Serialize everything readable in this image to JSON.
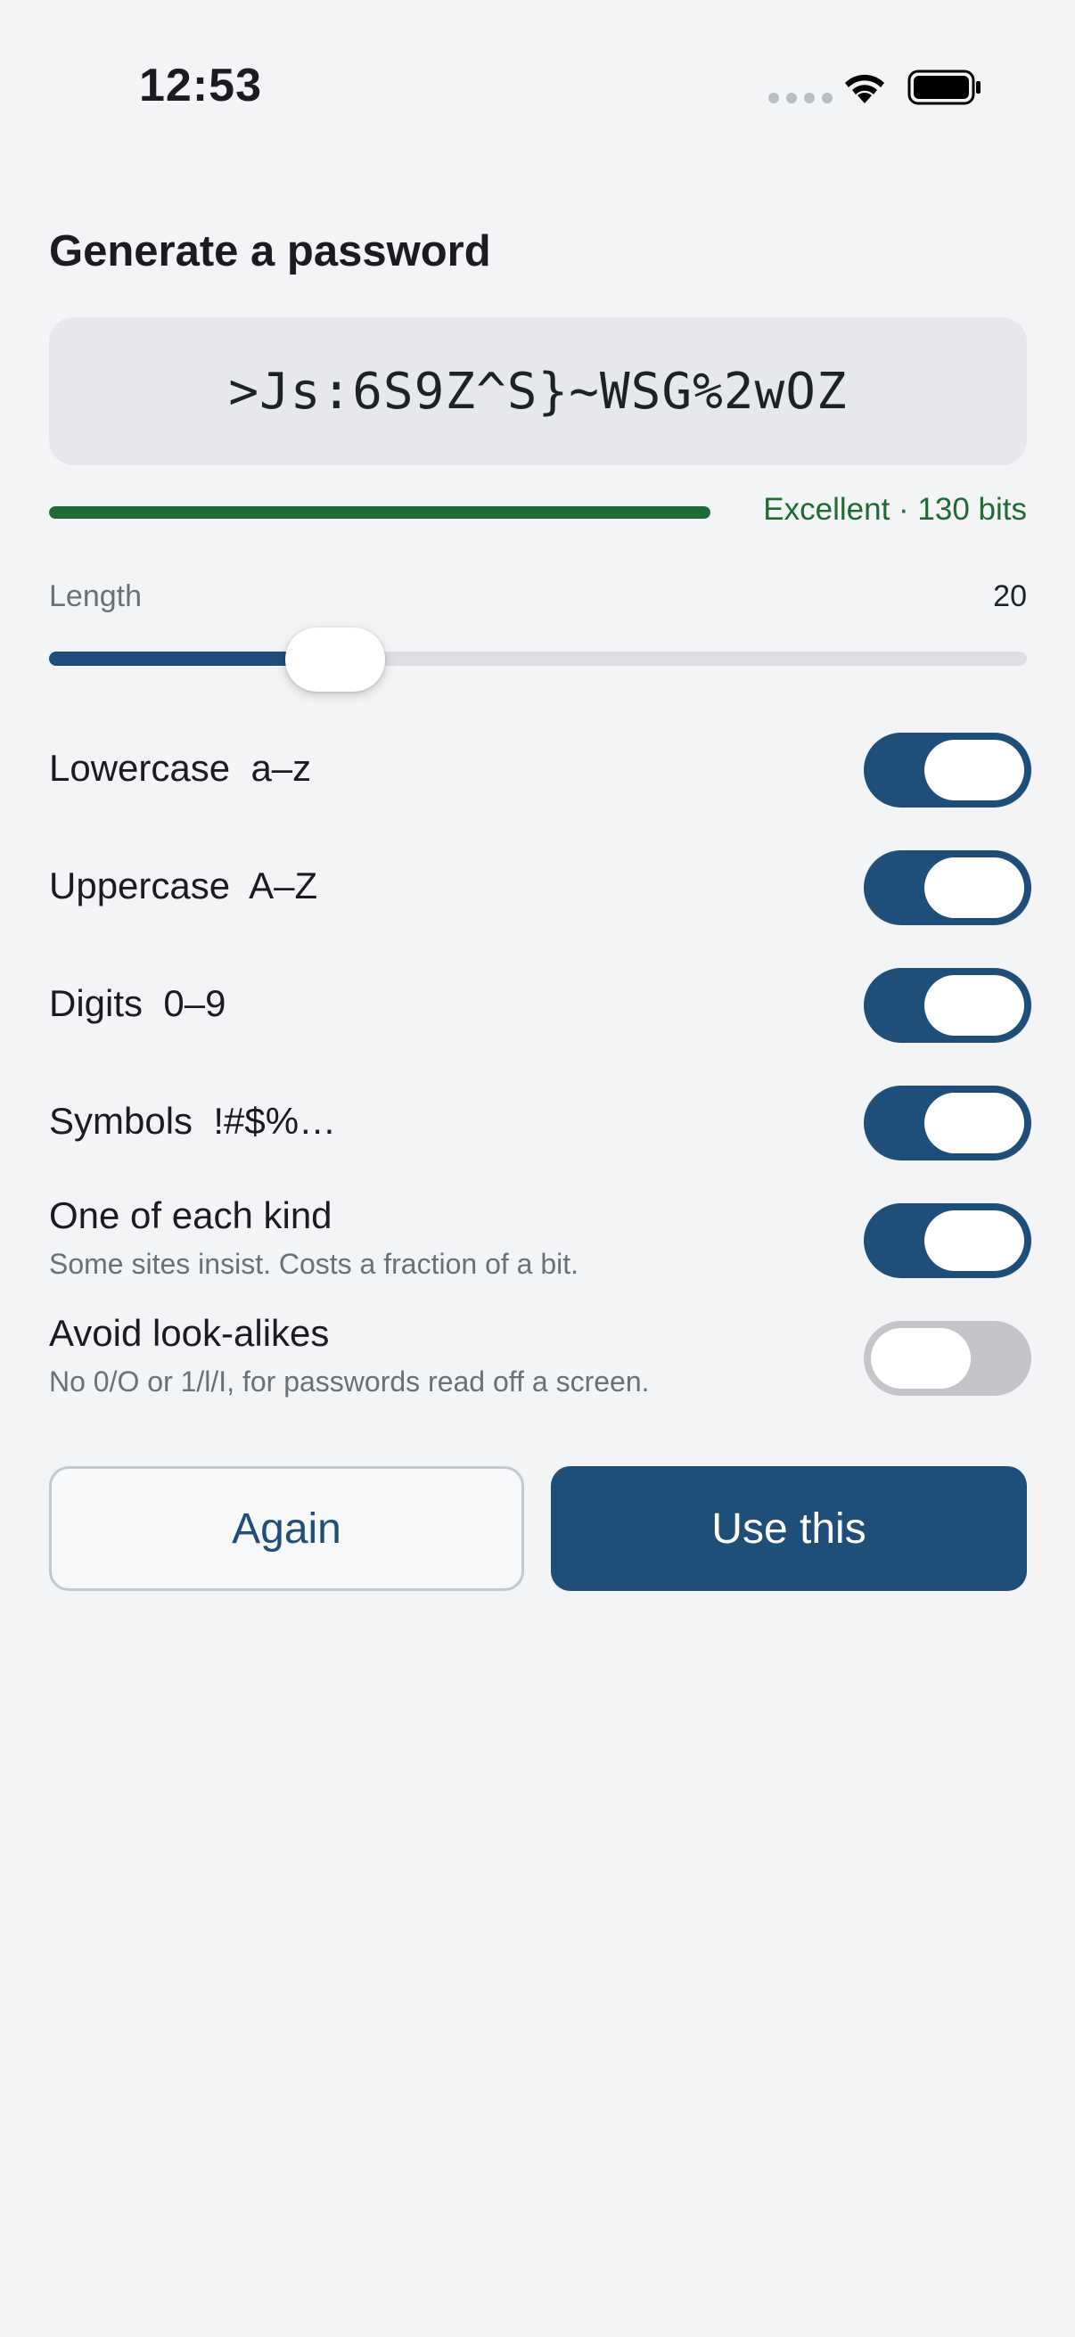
{
  "status_bar": {
    "time": "12:53"
  },
  "screen": {
    "title": "Generate a password"
  },
  "password": {
    "value": ">Js:6S9Z^S}~WSG%2wOZ"
  },
  "strength": {
    "label": "Excellent · 130 bits",
    "fill_fraction": 1.0,
    "color": "#1f6b35"
  },
  "length": {
    "label": "Length",
    "value": "20",
    "slider_fraction": 0.22
  },
  "options": [
    {
      "label": "Lowercase  a–z",
      "subtitle": "",
      "on": true
    },
    {
      "label": "Uppercase  A–Z",
      "subtitle": "",
      "on": true
    },
    {
      "label": "Digits  0–9",
      "subtitle": "",
      "on": true
    },
    {
      "label": "Symbols  !#$%…",
      "subtitle": "",
      "on": true
    },
    {
      "label": "One of each kind",
      "subtitle": "Some sites insist. Costs a fraction of a bit.",
      "on": true
    },
    {
      "label": "Avoid look-alikes",
      "subtitle": "No 0/O or 1/l/I, for passwords read off a screen.",
      "on": false
    }
  ],
  "buttons": {
    "again": "Again",
    "use": "Use this"
  },
  "colors": {
    "accent": "#1f4e79",
    "strength": "#1f6b35",
    "background": "#f3f4f6"
  },
  "icons": [
    "signal-icon",
    "wifi-icon",
    "battery-icon"
  ]
}
